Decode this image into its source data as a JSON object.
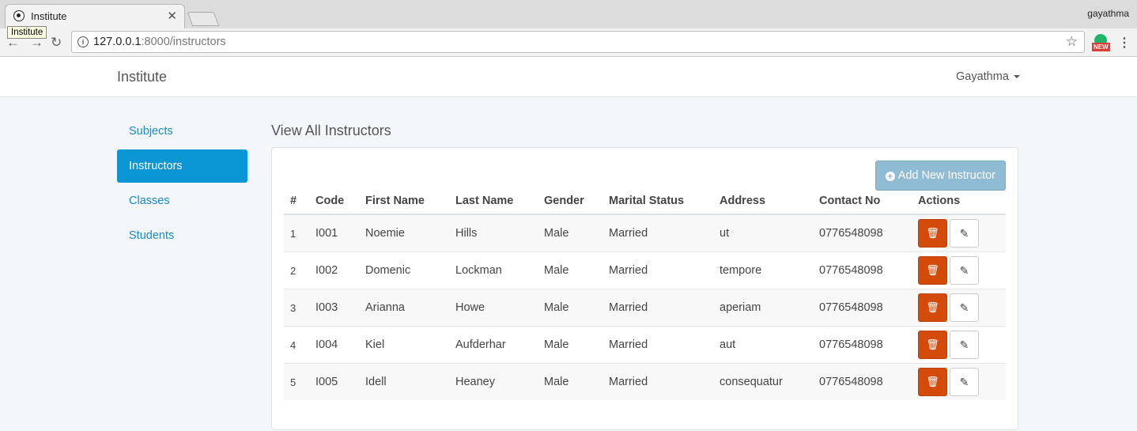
{
  "browser": {
    "tab_title": "Institute",
    "tooltip": "Institute",
    "profile": "gayathma",
    "url_host": "127.0.0.1",
    "url_rest": ":8000/instructors",
    "ext_badge": "NEW"
  },
  "app": {
    "brand": "Institute",
    "user": "Gayathma"
  },
  "sidebar": {
    "items": [
      {
        "label": "Subjects"
      },
      {
        "label": "Instructors"
      },
      {
        "label": "Classes"
      },
      {
        "label": "Students"
      }
    ]
  },
  "main": {
    "title": "View All Instructors",
    "add_button": "Add New Instructor",
    "columns": [
      "#",
      "Code",
      "First Name",
      "Last Name",
      "Gender",
      "Marital Status",
      "Address",
      "Contact No",
      "Actions"
    ],
    "rows": [
      {
        "idx": "1",
        "code": "I001",
        "first": "Noemie",
        "last": "Hills",
        "gender": "Male",
        "marital": "Married",
        "address": "ut",
        "contact": "0776548098"
      },
      {
        "idx": "2",
        "code": "I002",
        "first": "Domenic",
        "last": "Lockman",
        "gender": "Male",
        "marital": "Married",
        "address": "tempore",
        "contact": "0776548098"
      },
      {
        "idx": "3",
        "code": "I003",
        "first": "Arianna",
        "last": "Howe",
        "gender": "Male",
        "marital": "Married",
        "address": "aperiam",
        "contact": "0776548098"
      },
      {
        "idx": "4",
        "code": "I004",
        "first": "Kiel",
        "last": "Aufderhar",
        "gender": "Male",
        "marital": "Married",
        "address": "aut",
        "contact": "0776548098"
      },
      {
        "idx": "5",
        "code": "I005",
        "first": "Idell",
        "last": "Heaney",
        "gender": "Male",
        "marital": "Married",
        "address": "consequatur",
        "contact": "0776548098"
      }
    ]
  },
  "icons": {
    "delete": "trash-icon",
    "edit": "pencil-icon",
    "add": "plus-circle-icon"
  }
}
